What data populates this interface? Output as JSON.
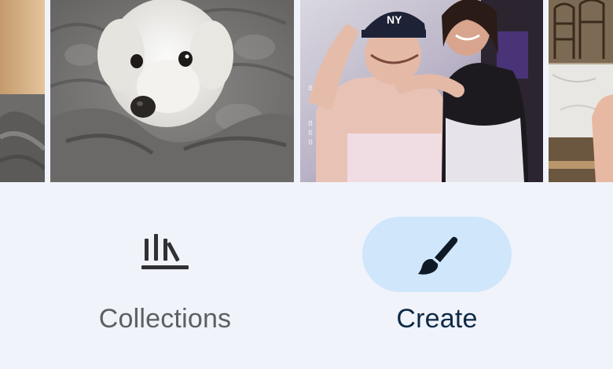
{
  "photos": [
    {
      "subject": "blanket-edge"
    },
    {
      "subject": "white-dog-in-blanket"
    },
    {
      "subject": "two-women-dancing"
    },
    {
      "subject": "cafe-table"
    }
  ],
  "nav": {
    "items": [
      {
        "label": "Collections",
        "icon": "collections-icon",
        "active": false
      },
      {
        "label": "Create",
        "icon": "brush-icon",
        "active": true
      }
    ]
  },
  "colors": {
    "background": "#f1f3fb",
    "active_pill": "#cfe6fb",
    "inactive_text": "#5c5f63",
    "active_text": "#0d2a45"
  }
}
